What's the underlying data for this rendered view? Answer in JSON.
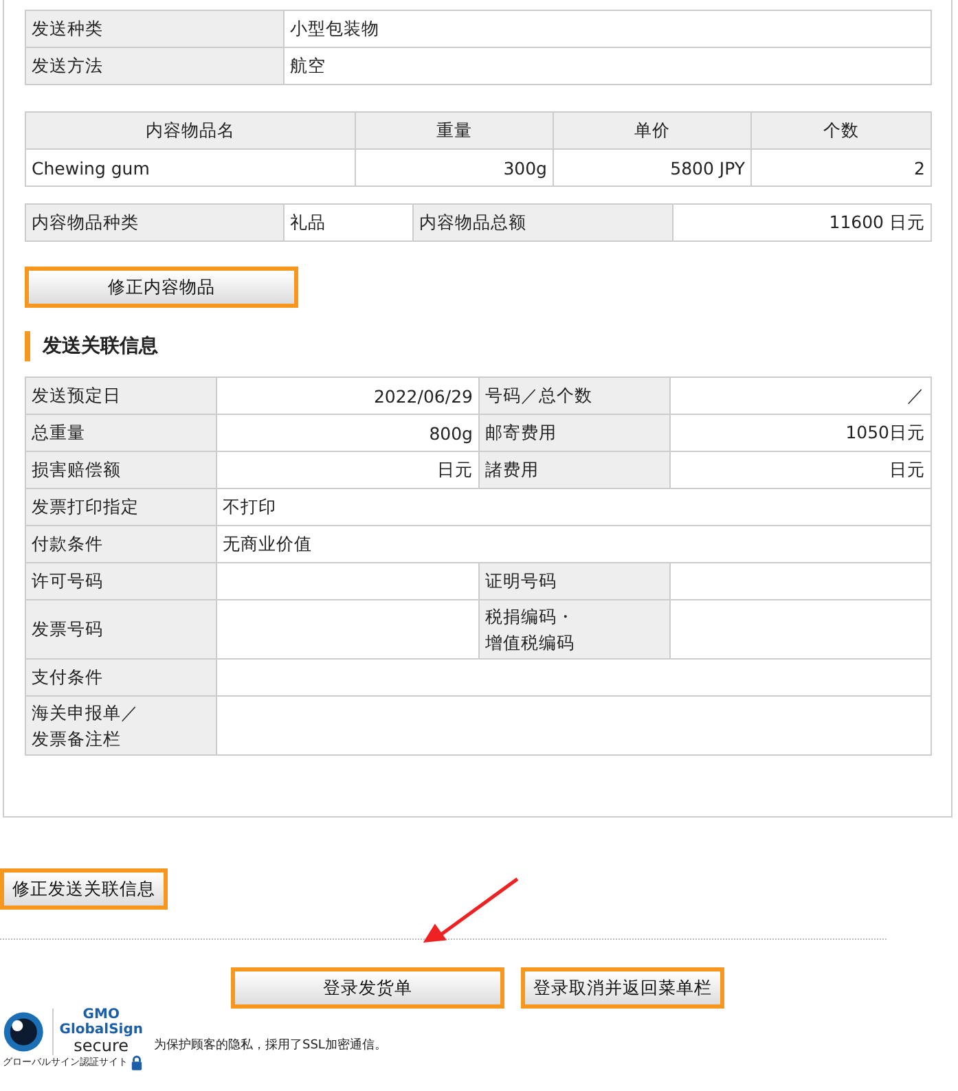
{
  "shipping": [
    {
      "label": "发送种类",
      "value": "小型包装物"
    },
    {
      "label": "发送方法",
      "value": "航空"
    }
  ],
  "items": {
    "columns": [
      "内容物品名",
      "重量",
      "单价",
      "个数"
    ],
    "rows": [
      [
        "Chewing gum",
        "300g",
        "5800 JPY",
        "2"
      ]
    ]
  },
  "summary": {
    "type_label": "内容物品种类",
    "type_value": "礼品",
    "total_label": "内容物品总额",
    "total_value": "11600 日元"
  },
  "edit_items_button": "修正内容物品",
  "section_title": "发送关联信息",
  "details": [
    {
      "cells": [
        {
          "kind": "label",
          "text": "发送预定日"
        },
        {
          "kind": "amount",
          "text": "2022/06/29"
        },
        {
          "kind": "label",
          "text": "号码／总个数"
        },
        {
          "kind": "amount",
          "text": "／"
        }
      ]
    },
    {
      "cells": [
        {
          "kind": "label",
          "text": "总重量"
        },
        {
          "kind": "amount",
          "text": "800g"
        },
        {
          "kind": "label",
          "text": "邮寄费用"
        },
        {
          "kind": "amount",
          "text": "1050日元"
        }
      ]
    },
    {
      "cells": [
        {
          "kind": "label",
          "text": "损害赔偿额"
        },
        {
          "kind": "amount",
          "text": "日元"
        },
        {
          "kind": "label",
          "text": "諸费用"
        },
        {
          "kind": "amount",
          "text": "日元"
        }
      ]
    },
    {
      "cells": [
        {
          "kind": "label",
          "text": "发票打印指定"
        },
        {
          "kind": "wide",
          "text": "不打印"
        }
      ]
    },
    {
      "cells": [
        {
          "kind": "label",
          "text": "付款条件"
        },
        {
          "kind": "wide",
          "text": "无商业价值"
        }
      ]
    },
    {
      "cells": [
        {
          "kind": "label",
          "text": "许可号码"
        },
        {
          "kind": "text"
        },
        {
          "kind": "label",
          "text": "证明号码"
        },
        {
          "kind": "text"
        }
      ]
    },
    {
      "cells": [
        {
          "kind": "label",
          "text": "发票号码"
        },
        {
          "kind": "text"
        },
        {
          "kind": "label",
          "lines": [
            "税捐编码・",
            "增值税编码"
          ]
        },
        {
          "kind": "text"
        }
      ]
    },
    {
      "cells": [
        {
          "kind": "label",
          "text": "支付条件"
        },
        {
          "kind": "wide"
        }
      ]
    },
    {
      "cells": [
        {
          "kind": "label",
          "lines": [
            "海关申报单／",
            "发票备注栏"
          ]
        },
        {
          "kind": "wide"
        }
      ]
    }
  ],
  "edit_details_button": "修正发送关联信息",
  "submit_button": "登录发货单",
  "cancel_button": "登录取消并返回菜单栏",
  "seal": {
    "brand": "GMO",
    "name": "GlobalSign",
    "word": "secure",
    "caption": "グローバルサイン認証サイト"
  },
  "ssl_note": "为保护顾客的隐私，採用了SSL加密通信。"
}
